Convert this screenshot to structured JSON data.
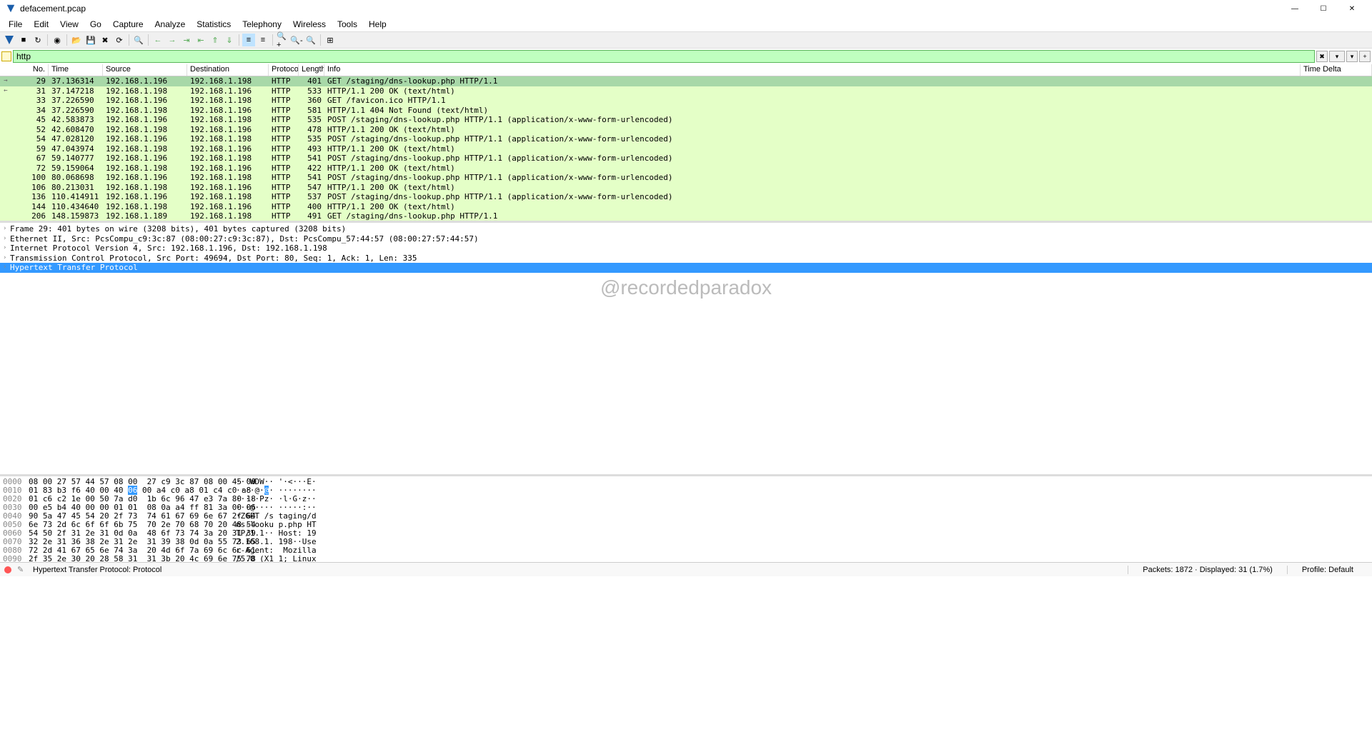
{
  "title": "defacement.pcap",
  "menu": [
    "File",
    "Edit",
    "View",
    "Go",
    "Capture",
    "Analyze",
    "Statistics",
    "Telephony",
    "Wireless",
    "Tools",
    "Help"
  ],
  "filter": "http",
  "columns": [
    "No.",
    "Time",
    "Source",
    "Destination",
    "Protocol",
    "Length",
    "Info",
    "Time Delta"
  ],
  "packets": [
    {
      "no": 29,
      "time": "37.136314",
      "src": "192.168.1.196",
      "dst": "192.168.1.198",
      "proto": "HTTP",
      "len": 401,
      "info": "GET /staging/dns-lookup.php HTTP/1.1",
      "ind": "→",
      "sel": true
    },
    {
      "no": 31,
      "time": "37.147218",
      "src": "192.168.1.198",
      "dst": "192.168.1.196",
      "proto": "HTTP",
      "len": 533,
      "info": "HTTP/1.1 200 OK  (text/html)",
      "ind": "←"
    },
    {
      "no": 33,
      "time": "37.226590",
      "src": "192.168.1.196",
      "dst": "192.168.1.198",
      "proto": "HTTP",
      "len": 360,
      "info": "GET /favicon.ico HTTP/1.1"
    },
    {
      "no": 34,
      "time": "37.226590",
      "src": "192.168.1.198",
      "dst": "192.168.1.196",
      "proto": "HTTP",
      "len": 581,
      "info": "HTTP/1.1 404 Not Found  (text/html)"
    },
    {
      "no": 45,
      "time": "42.583873",
      "src": "192.168.1.196",
      "dst": "192.168.1.198",
      "proto": "HTTP",
      "len": 535,
      "info": "POST /staging/dns-lookup.php HTTP/1.1  (application/x-www-form-urlencoded)"
    },
    {
      "no": 52,
      "time": "42.608470",
      "src": "192.168.1.198",
      "dst": "192.168.1.196",
      "proto": "HTTP",
      "len": 478,
      "info": "HTTP/1.1 200 OK  (text/html)"
    },
    {
      "no": 54,
      "time": "47.028120",
      "src": "192.168.1.196",
      "dst": "192.168.1.198",
      "proto": "HTTP",
      "len": 535,
      "info": "POST /staging/dns-lookup.php HTTP/1.1  (application/x-www-form-urlencoded)"
    },
    {
      "no": 59,
      "time": "47.043974",
      "src": "192.168.1.198",
      "dst": "192.168.1.196",
      "proto": "HTTP",
      "len": 493,
      "info": "HTTP/1.1 200 OK  (text/html)"
    },
    {
      "no": 67,
      "time": "59.140777",
      "src": "192.168.1.196",
      "dst": "192.168.1.198",
      "proto": "HTTP",
      "len": 541,
      "info": "POST /staging/dns-lookup.php HTTP/1.1  (application/x-www-form-urlencoded)"
    },
    {
      "no": 72,
      "time": "59.159064",
      "src": "192.168.1.198",
      "dst": "192.168.1.196",
      "proto": "HTTP",
      "len": 422,
      "info": "HTTP/1.1 200 OK  (text/html)"
    },
    {
      "no": 100,
      "time": "80.068698",
      "src": "192.168.1.196",
      "dst": "192.168.1.198",
      "proto": "HTTP",
      "len": 541,
      "info": "POST /staging/dns-lookup.php HTTP/1.1  (application/x-www-form-urlencoded)"
    },
    {
      "no": 106,
      "time": "80.213031",
      "src": "192.168.1.198",
      "dst": "192.168.1.196",
      "proto": "HTTP",
      "len": 547,
      "info": "HTTP/1.1 200 OK  (text/html)"
    },
    {
      "no": 136,
      "time": "110.414911",
      "src": "192.168.1.196",
      "dst": "192.168.1.198",
      "proto": "HTTP",
      "len": 537,
      "info": "POST /staging/dns-lookup.php HTTP/1.1  (application/x-www-form-urlencoded)"
    },
    {
      "no": 144,
      "time": "110.434640",
      "src": "192.168.1.198",
      "dst": "192.168.1.196",
      "proto": "HTTP",
      "len": 400,
      "info": "HTTP/1.1 200 OK  (text/html)"
    },
    {
      "no": 206,
      "time": "148.159873",
      "src": "192.168.1.189",
      "dst": "192.168.1.198",
      "proto": "HTTP",
      "len": 491,
      "info": "GET /staging/dns-lookup.php HTTP/1.1"
    }
  ],
  "details": [
    "Frame 29: 401 bytes on wire (3208 bits), 401 bytes captured (3208 bits)",
    "Ethernet II, Src: PcsCompu_c9:3c:87 (08:00:27:c9:3c:87), Dst: PcsCompu_57:44:57 (08:00:27:57:44:57)",
    "Internet Protocol Version 4, Src: 192.168.1.196, Dst: 192.168.1.198",
    "Transmission Control Protocol, Src Port: 49694, Dst Port: 80, Seq: 1, Ack: 1, Len: 335",
    "Hypertext Transfer Protocol"
  ],
  "watermark": "@recordedparadox",
  "hex": [
    {
      "off": "0000",
      "b": "08 00 27 57 44 57 08 00  27 c9 3c 87 08 00 45 00",
      "a": "··'WDW·· '·<···E·"
    },
    {
      "off": "0010",
      "b": "01 83 b3 f6 40 00 40 06  00 a4 c0 a8 01 c4 c0 a8",
      "a": "····@·@· ········",
      "hlb": 7,
      "hla": 6
    },
    {
      "off": "0020",
      "b": "01 c6 c2 1e 00 50 7a d0  1b 6c 96 47 e3 7a 80 18",
      "a": "·····Pz· ·l·G·z··"
    },
    {
      "off": "0030",
      "b": "00 e5 b4 40 00 00 01 01  08 0a a4 ff 81 3a 00 06",
      "a": "···@···· ·····:··"
    },
    {
      "off": "0040",
      "b": "90 5a 47 45 54 20 2f 73  74 61 67 69 6e 67 2f 64",
      "a": "·ZGET /s taging/d"
    },
    {
      "off": "0050",
      "b": "6e 73 2d 6c 6f 6f 6b 75  70 2e 70 68 70 20 48 54",
      "a": "ns-looku p.php HT"
    },
    {
      "off": "0060",
      "b": "54 50 2f 31 2e 31 0d 0a  48 6f 73 74 3a 20 31 39",
      "a": "TP/1.1·· Host: 19"
    },
    {
      "off": "0070",
      "b": "32 2e 31 36 38 2e 31 2e  31 39 38 0d 0a 55 73 65",
      "a": "2.168.1. 198··Use"
    },
    {
      "off": "0080",
      "b": "72 2d 41 67 65 6e 74 3a  20 4d 6f 7a 69 6c 6c 61",
      "a": "r-Agent:  Mozilla"
    },
    {
      "off": "0090",
      "b": "2f 35 2e 30 20 28 58 31  31 3b 20 4c 69 6e 75 78",
      "a": "/5.0 (X1 1; Linux"
    }
  ],
  "status": {
    "left": "Hypertext Transfer Protocol: Protocol",
    "mid": "Packets: 1872 · Displayed: 31 (1.7%)",
    "right": "Profile: Default"
  }
}
